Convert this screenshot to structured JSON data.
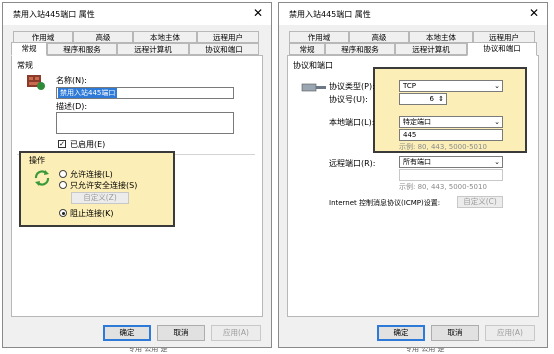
{
  "background": {
    "strip_left": "专用  公用  是",
    "strip_right": "专用  公用  是"
  },
  "dialog1": {
    "title": "禁用入站445端口 属性",
    "close_glyph": "✕",
    "tabs_top": [
      "作用域",
      "高级",
      "本地主体",
      "远程用户"
    ],
    "tabs_bottom": [
      "常规",
      "程序和服务",
      "远程计算机",
      "协议和端口"
    ],
    "general": {
      "section": "常规",
      "name_label": "名称(N):",
      "name_value": "禁用入站445端口",
      "desc_label": "描述(D):",
      "desc_value": "",
      "enabled_label": "已启用(E)",
      "enabled": true
    },
    "action": {
      "section": "操作",
      "allow_label": "允许连接(L)",
      "allow_secure_label": "只允许安全连接(S)",
      "custom_button": "自定义(Z)",
      "block_label": "阻止连接(K)",
      "selected": "block"
    },
    "buttons": {
      "ok": "确定",
      "cancel": "取消",
      "apply": "应用(A)"
    },
    "highlight_color": "#fbeeb6"
  },
  "dialog2": {
    "title": "禁用入站445端口 属性",
    "close_glyph": "✕",
    "tabs_top": [
      "作用域",
      "高级",
      "本地主体",
      "远程用户"
    ],
    "tabs_bottom": [
      "常规",
      "程序和服务",
      "远程计算机",
      "协议和端口"
    ],
    "protocols": {
      "section": "协议和端口",
      "protocol_type_label": "协议类型(P):",
      "protocol_type_value": "TCP",
      "protocol_number_label": "协议号(U):",
      "protocol_number_value": "6",
      "local_port_label": "本地端口(L):",
      "local_port_value": "特定端口",
      "local_port_input": "445",
      "local_example": "示例: 80, 443, 5000-5010",
      "remote_port_label": "远程端口(R):",
      "remote_port_value": "所有端口",
      "remote_example": "示例: 80, 443, 5000-5010",
      "icmp_label": "Internet 控制消息协议(ICMP)设置:",
      "icmp_button": "自定义(C)"
    },
    "buttons": {
      "ok": "确定",
      "cancel": "取消",
      "apply": "应用(A)"
    }
  }
}
